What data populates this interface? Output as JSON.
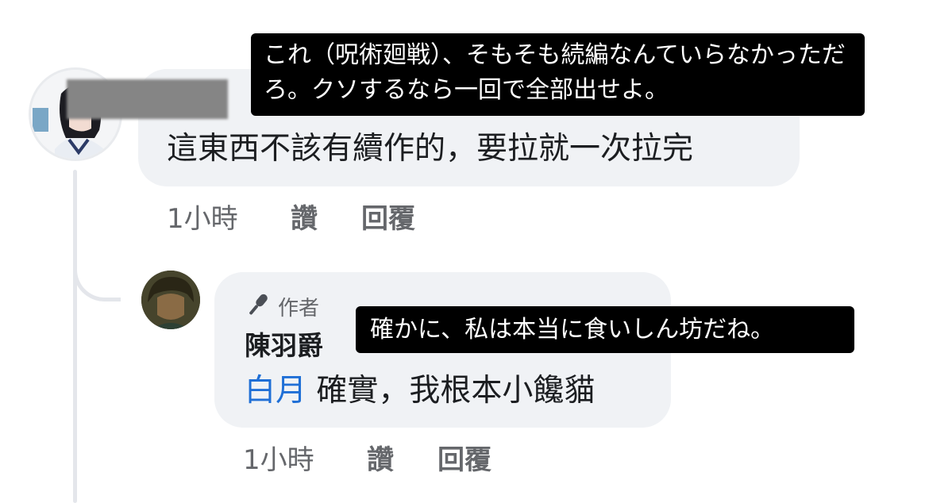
{
  "comment": {
    "text": "這東西不該有續作的，要拉就一次拉完",
    "time": "1小時",
    "like_label": "讚",
    "reply_label": "回覆"
  },
  "reply": {
    "author_badge": "作者",
    "author_name": "陳羽爵",
    "mention": "白月",
    "text": "確實，我根本小饞貓",
    "time": "1小時",
    "like_label": "讚",
    "reply_label": "回覆"
  },
  "overlays": {
    "translation_1": "これ（呪術廻戦）、そもそも続編なんていらなかっただろ。クソするなら一回で全部出せよ。",
    "translation_2": "確かに、私は本当に食いしん坊だね。"
  },
  "icons": {
    "author_badge_icon": "microphone-icon"
  },
  "colors": {
    "bubble": "#f0f2f5",
    "meta_text": "#65676b",
    "mention": "#1f6fd6",
    "overlay_bg": "#000000"
  }
}
